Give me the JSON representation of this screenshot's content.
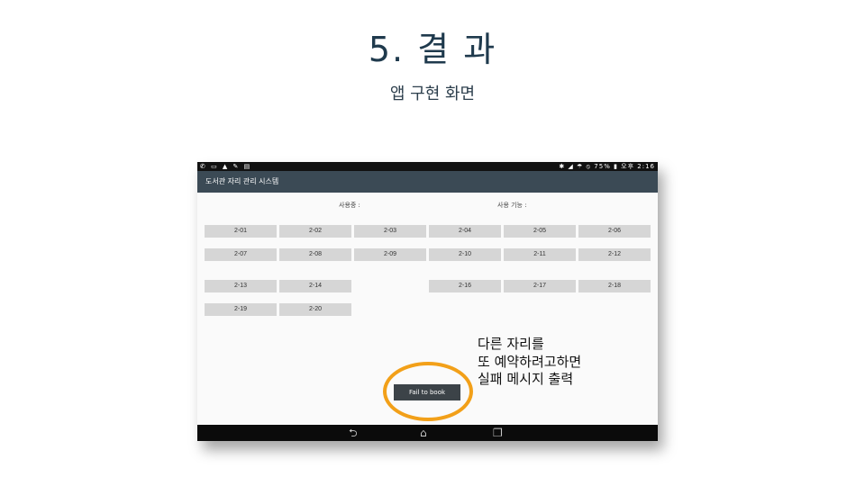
{
  "slide": {
    "title": "5. 결 과",
    "subtitle": "앱 구현 화면"
  },
  "tablet": {
    "status_left": "✆ ▭ ▲ ✎ ▤",
    "status_right": "✱ ◢ ☂ ⦸ 75% ▮ 오후 2:16",
    "app_title": "도서관 자리 관리 시스템",
    "user_label": "사용중 :",
    "function_label": "사용 기능 :",
    "seats_row1": [
      "2-01",
      "2-02",
      "2-03",
      "2-04",
      "2-05",
      "2-06"
    ],
    "seats_row2": [
      "2-07",
      "2-08",
      "2-09",
      "2-10",
      "2-11",
      "2-12"
    ],
    "seats_row3": [
      "2-13",
      "2-14",
      "2-16",
      "2-17",
      "2-18"
    ],
    "seats_row4": [
      "2-19",
      "2-20"
    ],
    "toast": "Fail to book",
    "nav": {
      "back_icon": "back-icon",
      "home_icon": "home-icon",
      "recents_icon": "recents-icon"
    }
  },
  "annotation": {
    "lines": [
      "다른 자리를",
      "또 예약하려고하면",
      "실패 메시지 출력"
    ],
    "highlight_color": "#f2a019"
  }
}
